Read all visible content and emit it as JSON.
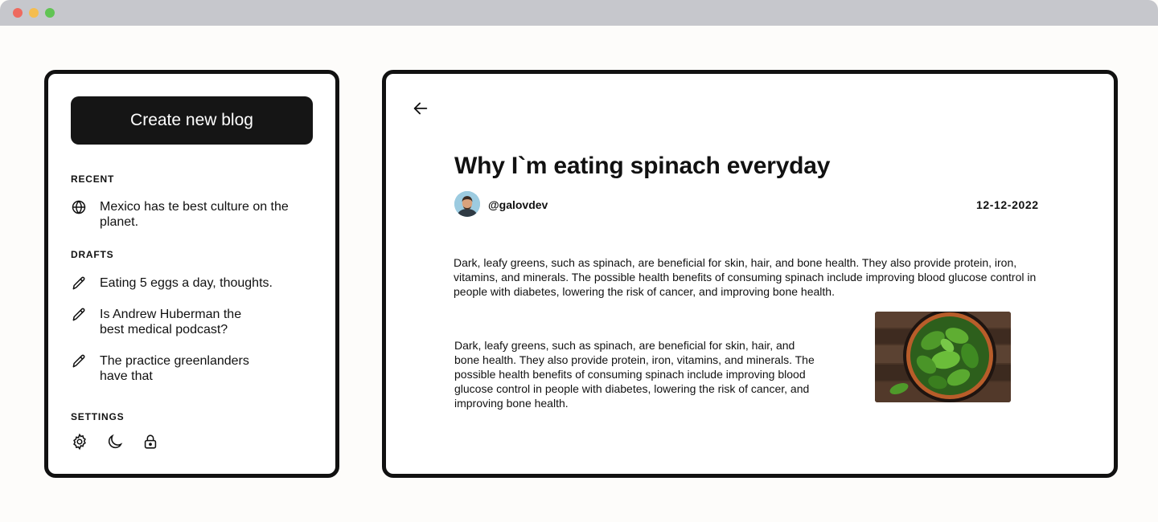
{
  "sidebar": {
    "create_button": "Create new blog",
    "recent_label": "RECENT",
    "recent_items": [
      {
        "label": "Mexico has te best culture on the planet.",
        "icon": "globe-icon"
      }
    ],
    "drafts_label": "DRAFTS",
    "draft_items": [
      {
        "label": "Eating 5 eggs a day, thoughts.",
        "icon": "pencil-icon"
      },
      {
        "label": "Is Andrew Huberman the best medical podcast?",
        "icon": "pencil-icon"
      },
      {
        "label": "The practice greenlanders have that",
        "icon": "pencil-icon"
      }
    ],
    "settings_label": "SETTINGS",
    "settings_icons": [
      "gear-icon",
      "moon-icon",
      "lock-icon"
    ]
  },
  "post": {
    "title": "Why I`m eating spinach everyday",
    "author": "@galovdev",
    "date": "12-12-2022",
    "paragraph_1": "Dark, leafy greens, such as spinach, are beneficial for skin, hair, and bone health. They also provide protein, iron, vitamins, and minerals. The possible health benefits of consuming spinach include improving blood glucose control in people with diabetes, lowering the risk of cancer, and improving bone health.",
    "paragraph_2": "Dark, leafy greens, such as spinach, are beneficial for skin, hair, and bone health. They also provide protein, iron, vitamins, and minerals. The possible health benefits of consuming spinach include improving blood glucose control in people with diabetes, lowering the risk of cancer, and improving bone health."
  },
  "colors": {
    "frame_border": "#111111",
    "button_bg": "#151515",
    "titlebar": "#c6c7cc"
  }
}
